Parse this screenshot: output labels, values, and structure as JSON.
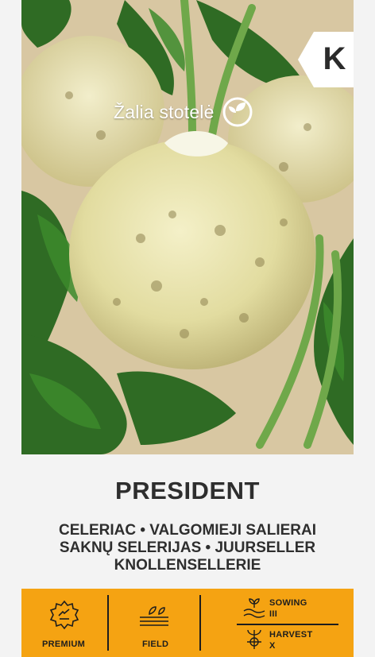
{
  "brand": {
    "name": "Žalia stotelė",
    "logo_icon": "sprout-circle-logo-icon"
  },
  "category_badge": "K",
  "product": {
    "title": "PRESIDENT",
    "names_line1": "CELERIAC • VALGOMIEJI SALIERAI",
    "names_line2": "SAKNŲ SELERIJAS • JUURSELLER",
    "names_line3": "KNOLLENSELLERIE"
  },
  "info_bar": {
    "background": "#f5a312",
    "premium_label": "PREMIUM",
    "field_label": "FIELD",
    "sowing_label": "SOWING",
    "sowing_value": "III",
    "harvest_label": "HARVEST",
    "harvest_value": "X"
  }
}
